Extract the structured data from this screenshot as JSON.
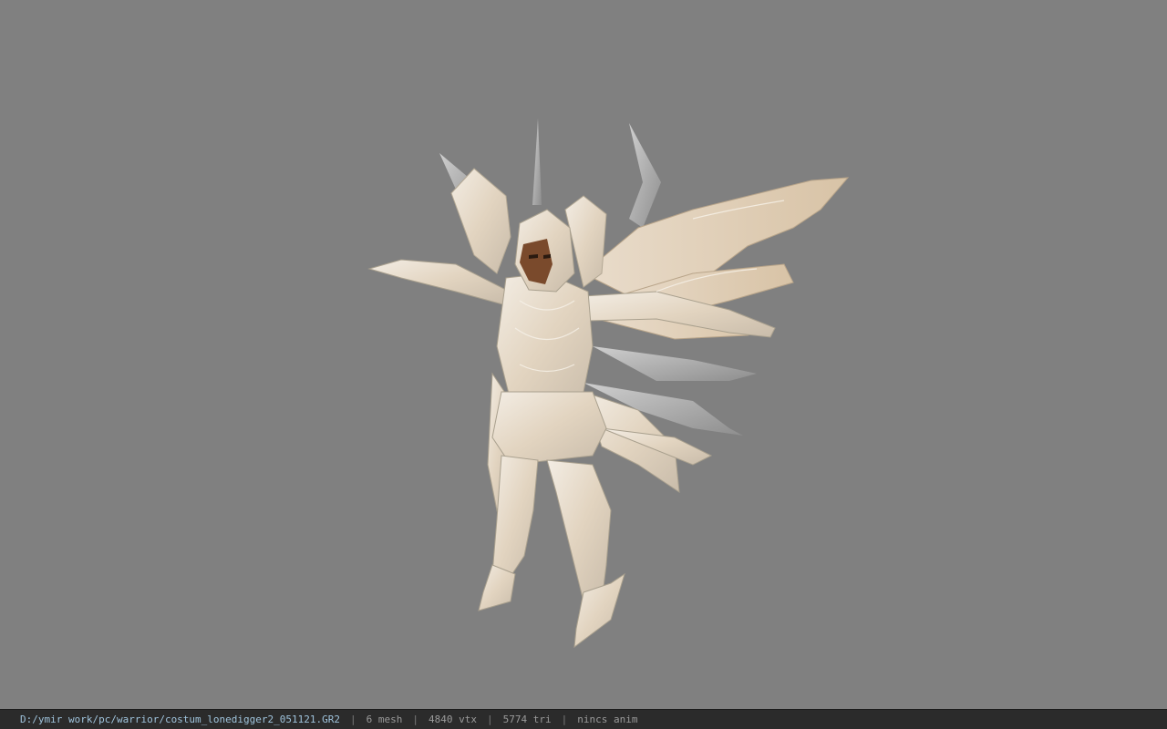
{
  "viewer": {
    "background_color": "#808080",
    "model_icon": "winged-armored-warrior-model"
  },
  "statusbar": {
    "path": "D:/ymir work/pc/warrior/costum_lonedigger2_051121.GR2",
    "separator": "|",
    "mesh": "6 mesh",
    "vtx": "4840 vtx",
    "tri": "5774 tri",
    "anim": "nincs anim"
  }
}
